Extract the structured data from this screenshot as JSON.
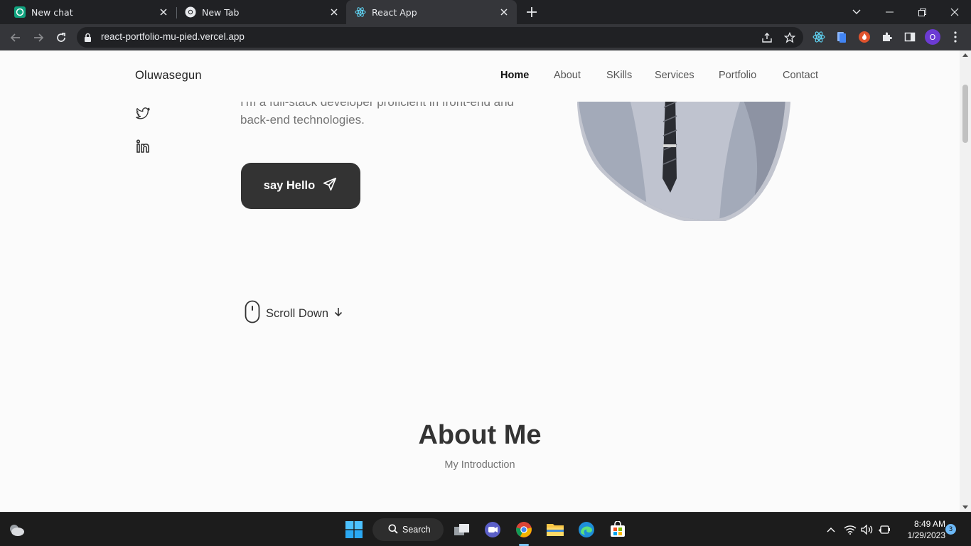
{
  "browser": {
    "tabs": [
      {
        "title": "New chat",
        "favicon": "chatgpt-icon"
      },
      {
        "title": "New Tab",
        "favicon": "chrome-icon"
      },
      {
        "title": "React App",
        "favicon": "react-icon"
      }
    ],
    "url": "react-portfolio-mu-pied.vercel.app",
    "profile_initial": "O"
  },
  "site": {
    "logo": "Oluwasegun",
    "nav": [
      {
        "label": "Home",
        "active": true
      },
      {
        "label": "About"
      },
      {
        "label": "SKills"
      },
      {
        "label": "Services"
      },
      {
        "label": "Portfolio"
      },
      {
        "label": "Contact"
      }
    ],
    "hero": {
      "description": "I'm a full-stack developer proficient in front-end and back-end technologies.",
      "cta_label": "say Hello"
    },
    "scroll_down": "Scroll Down",
    "about": {
      "title": "About Me",
      "subtitle": "My Introduction"
    }
  },
  "taskbar": {
    "search_label": "Search",
    "time": "8:49 AM",
    "date": "1/29/2023",
    "notification_count": "3"
  },
  "colors": {
    "chrome_dark": "#202124",
    "chrome_toolbar": "#35363a",
    "page_bg": "#fbfbfb",
    "button_dark": "#333333",
    "taskbar": "#1c1c1c"
  }
}
